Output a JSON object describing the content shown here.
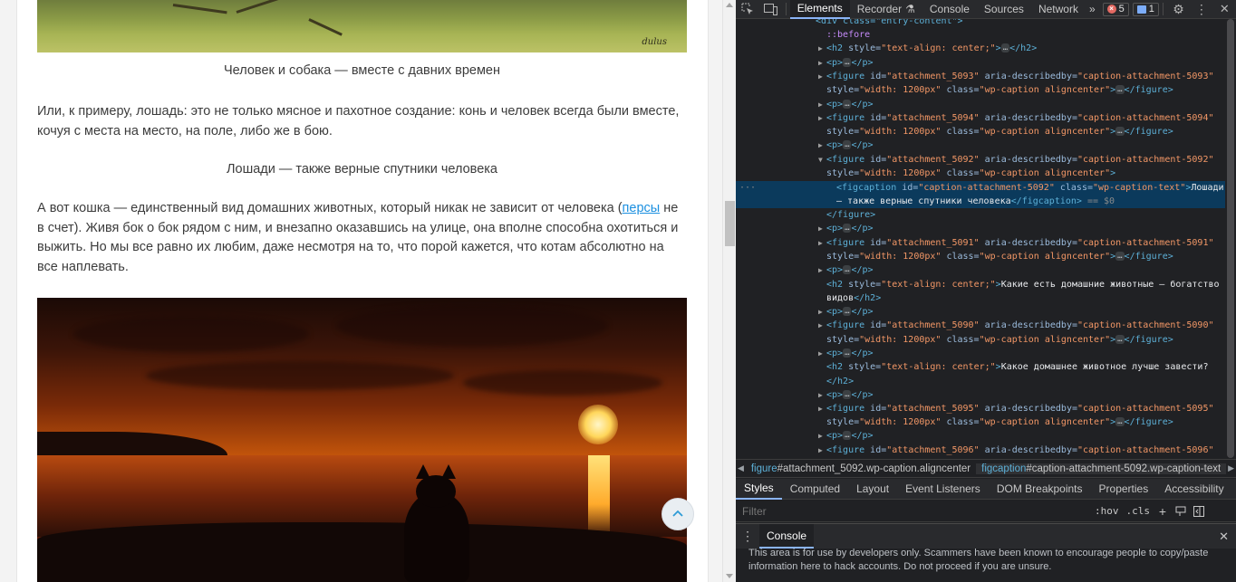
{
  "article": {
    "caption_dog": "Человек и собака — вместе с давних времен",
    "para_horse": "Или, к примеру, лошадь: это не только мясное и пахотное создание: конь и человек всегда были вместе, кочуя с места на место, на поле, либо же в бою.",
    "caption_horse": "Лошади — также верные спутники человека",
    "para_cat_before": "А вот кошка — единственный вид домашних животных, который никак не зависит от человека (",
    "para_cat_link": "персы",
    "para_cat_after": " не в счет). Живя бок о бок рядом с ним, и внезапно оказавшись на улице, она вполне способна охотиться и выжить. Но мы все равно их любим, даже несмотря на то, что порой кажется, что котам абсолютно на все наплевать.",
    "image_signature": "dulus"
  },
  "devtools": {
    "tabs": [
      "Elements",
      "Recorder",
      "Console",
      "Sources",
      "Network"
    ],
    "active_tab": "Elements",
    "error_count": "5",
    "message_count": "1",
    "dom_lines": [
      {
        "t": "<div class=\"entry-content\">"
      },
      {
        "t": "::before"
      },
      {
        "t1": "<h2",
        "a1": " style=",
        "v1": "\"text-align: center;\"",
        "t2": ">",
        "e": "…",
        "t3": "</h2>"
      },
      {
        "t1": "<p>",
        "e": "…",
        "t3": "</p>"
      },
      {
        "t1": "<figure",
        "a1": " id=",
        "v1": "\"attachment_5093\"",
        "a2": " aria-describedby=",
        "v2": "\"caption-attachment-5093\""
      },
      {
        "a1": "style=",
        "v1": "\"width: 1200px\"",
        "a2": " class=",
        "v2": "\"wp-caption aligncenter\"",
        "t2": ">",
        "e": "…",
        "t3": "</figure>"
      },
      {
        "t1": "<p>",
        "e": "…",
        "t3": "</p>"
      },
      {
        "t1": "<figure",
        "a1": " id=",
        "v1": "\"attachment_5094\"",
        "a2": " aria-describedby=",
        "v2": "\"caption-attachment-5094\""
      },
      {
        "a1": "style=",
        "v1": "\"width: 1200px\"",
        "a2": " class=",
        "v2": "\"wp-caption aligncenter\"",
        "t2": ">",
        "e": "…",
        "t3": "</figure>"
      },
      {
        "t1": "<p>",
        "e": "…",
        "t3": "</p>"
      },
      {
        "t1": "<figure",
        "a1": " id=",
        "v1": "\"attachment_5092\"",
        "a2": " aria-describedby=",
        "v2": "\"caption-attachment-5092\""
      },
      {
        "a1": "style=",
        "v1": "\"width: 1200px\"",
        "a2": " class=",
        "v2": "\"wp-caption aligncenter\"",
        "t2": ">"
      },
      {
        "t1": "<figcaption",
        "a1": " id=",
        "v1": "\"caption-attachment-5092\"",
        "a2": " class=",
        "v2": "\"wp-caption-text\"",
        "t2": ">",
        "x": "Лошади"
      },
      {
        "x": "— также верные спутники человека",
        "t3": "</figcaption>",
        "d": " == $0"
      },
      {
        "t3": "</figure>"
      },
      {
        "t1": "<p>",
        "e": "…",
        "t3": "</p>"
      },
      {
        "t1": "<figure",
        "a1": " id=",
        "v1": "\"attachment_5091\"",
        "a2": " aria-describedby=",
        "v2": "\"caption-attachment-5091\""
      },
      {
        "a1": "style=",
        "v1": "\"width: 1200px\"",
        "a2": " class=",
        "v2": "\"wp-caption aligncenter\"",
        "t2": ">",
        "e": "…",
        "t3": "</figure>"
      },
      {
        "t1": "<p>",
        "e": "…",
        "t3": "</p>"
      },
      {
        "t1": "<h2",
        "a1": " style=",
        "v1": "\"text-align: center;\"",
        "t2": ">",
        "x": "Какие есть домашние животные — богатство"
      },
      {
        "x": "видов",
        "t3": "</h2>"
      },
      {
        "t1": "<p>",
        "e": "…",
        "t3": "</p>"
      },
      {
        "t1": "<figure",
        "a1": " id=",
        "v1": "\"attachment_5090\"",
        "a2": " aria-describedby=",
        "v2": "\"caption-attachment-5090\""
      },
      {
        "a1": "style=",
        "v1": "\"width: 1200px\"",
        "a2": " class=",
        "v2": "\"wp-caption aligncenter\"",
        "t2": ">",
        "e": "…",
        "t3": "</figure>"
      },
      {
        "t1": "<p>",
        "e": "…",
        "t3": "</p>"
      },
      {
        "t1": "<h2",
        "a1": " style=",
        "v1": "\"text-align: center;\"",
        "t2": ">",
        "x": "Какое домашнее животное лучше завести?"
      },
      {
        "t3": "</h2>"
      },
      {
        "t1": "<p>",
        "e": "…",
        "t3": "</p>"
      },
      {
        "t1": "<figure",
        "a1": " id=",
        "v1": "\"attachment_5095\"",
        "a2": " aria-describedby=",
        "v2": "\"caption-attachment-5095\""
      },
      {
        "a1": "style=",
        "v1": "\"width: 1200px\"",
        "a2": " class=",
        "v2": "\"wp-caption aligncenter\"",
        "t2": ">",
        "e": "…",
        "t3": "</figure>"
      },
      {
        "t1": "<p>",
        "e": "…",
        "t3": "</p>"
      },
      {
        "t1": "<figure",
        "a1": " id=",
        "v1": "\"attachment_5096\"",
        "a2": " aria-describedby=",
        "v2": "\"caption-attachment-5096\""
      }
    ],
    "breadcrumb": [
      {
        "tag": "figure",
        "rest": "#attachment_5092.wp-caption.aligncenter"
      },
      {
        "tag": "figcaption",
        "rest": "#caption-attachment-5092.wp-caption-text"
      }
    ],
    "styles_tabs": [
      "Styles",
      "Computed",
      "Layout",
      "Event Listeners",
      "DOM Breakpoints",
      "Properties",
      "Accessibility"
    ],
    "active_styles_tab": "Styles",
    "filter_placeholder": "Filter",
    "hov_label": ":hov",
    "cls_label": ".cls",
    "drawer_tab": "Console",
    "console_warning_1": "This area is for use by developers only. Scammers have been known to encourage people to copy/paste",
    "console_warning_2": "information here to hack accounts. Do not proceed if you are unsure."
  }
}
